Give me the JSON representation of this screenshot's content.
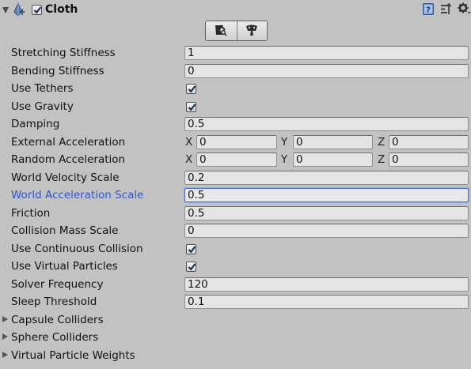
{
  "component": {
    "title": "Cloth",
    "enabled": true,
    "toolbar": [
      {
        "name": "edit-constraints",
        "icon": "cloth-vertex-icon"
      },
      {
        "name": "edit-collision-particles",
        "icon": "cloth-self-collision-icon"
      }
    ]
  },
  "properties": {
    "stretching_stiffness": {
      "label": "Stretching Stiffness",
      "value": "1"
    },
    "bending_stiffness": {
      "label": "Bending Stiffness",
      "value": "0"
    },
    "use_tethers": {
      "label": "Use Tethers",
      "checked": true
    },
    "use_gravity": {
      "label": "Use Gravity",
      "checked": true
    },
    "damping": {
      "label": "Damping",
      "value": "0.5"
    },
    "external_acceleration": {
      "label": "External Acceleration",
      "x_label": "X",
      "y_label": "Y",
      "z_label": "Z",
      "x": "0",
      "y": "0",
      "z": "0"
    },
    "random_acceleration": {
      "label": "Random Acceleration",
      "x_label": "X",
      "y_label": "Y",
      "z_label": "Z",
      "x": "0",
      "y": "0",
      "z": "0"
    },
    "world_velocity_scale": {
      "label": "World Velocity Scale",
      "value": "0.2"
    },
    "world_acceleration_scale": {
      "label": "World Acceleration Scale",
      "value": "0.5",
      "focused": true
    },
    "friction": {
      "label": "Friction",
      "value": "0.5"
    },
    "collision_mass_scale": {
      "label": "Collision Mass Scale",
      "value": "0"
    },
    "use_continuous_collision": {
      "label": "Use Continuous Collision",
      "checked": true
    },
    "use_virtual_particles": {
      "label": "Use Virtual Particles",
      "checked": true
    },
    "solver_frequency": {
      "label": "Solver Frequency",
      "value": "120"
    },
    "sleep_threshold": {
      "label": "Sleep Threshold",
      "value": "0.1"
    }
  },
  "foldouts": [
    {
      "label": "Capsule Colliders",
      "expanded": false
    },
    {
      "label": "Sphere Colliders",
      "expanded": false
    },
    {
      "label": "Virtual Particle Weights",
      "expanded": false
    }
  ],
  "colors": {
    "background": "#c2c2c2",
    "field": "#e4e4e4",
    "focus_label": "#2f55c6",
    "focus_border": "#4a72d4"
  }
}
